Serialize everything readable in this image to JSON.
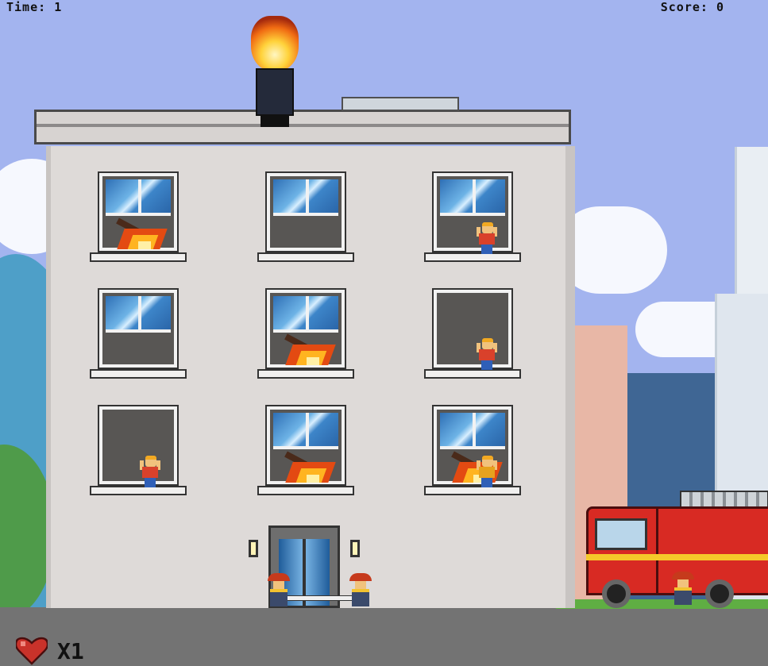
{
  "hud": {
    "time_label": "Time:",
    "time_value": "1",
    "score_label": "Score:",
    "score_value": "0"
  },
  "lives": {
    "prefix": "X",
    "count": "1"
  },
  "colors": {
    "sky": "#a3b4ef",
    "ground": "#737373",
    "building": "#dedad8",
    "fire": "#e34a12",
    "truck": "#d82a23"
  },
  "icons": [
    "heart-icon"
  ]
}
